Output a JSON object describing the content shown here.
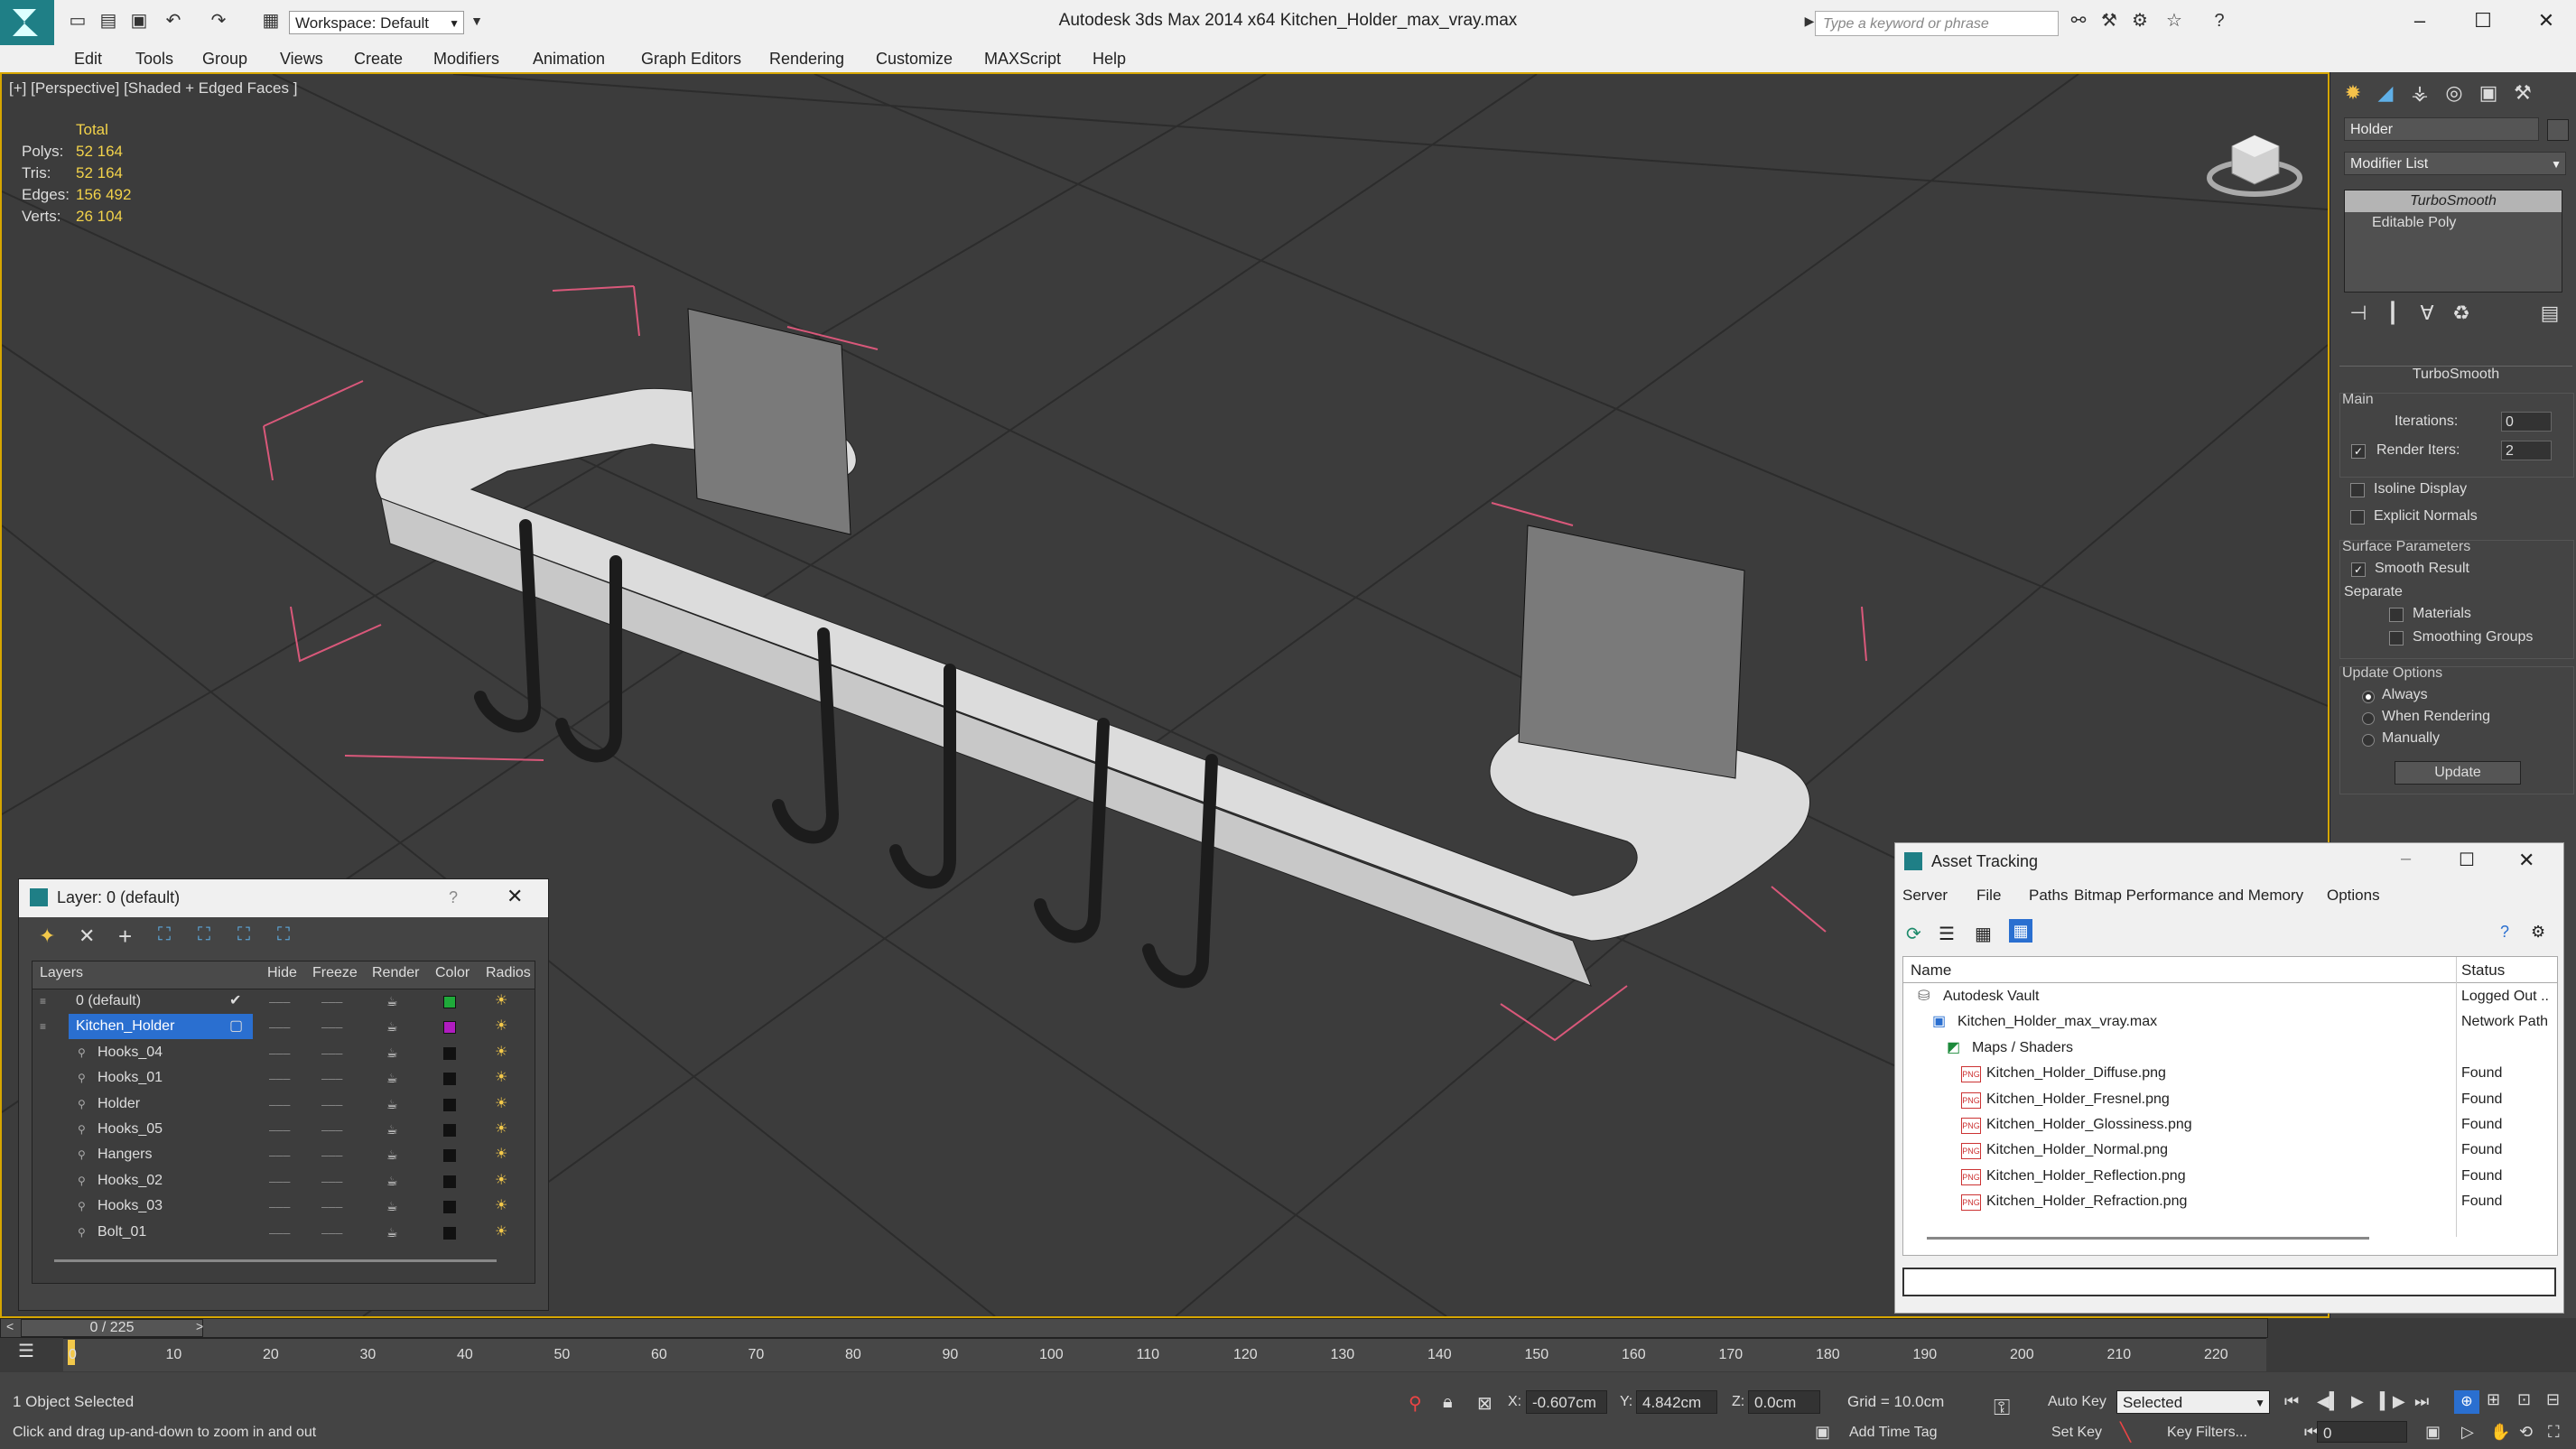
{
  "app": {
    "title": "Autodesk 3ds Max  2014 x64     Kitchen_Holder_max_vray.max",
    "workspace": "Workspace: Default",
    "search_placeholder": "Type a keyword or phrase"
  },
  "menu": [
    "Edit",
    "Tools",
    "Group",
    "Views",
    "Create",
    "Modifiers",
    "Animation",
    "Graph Editors",
    "Rendering",
    "Customize",
    "MAXScript",
    "Help"
  ],
  "viewport": {
    "label": "[+] [Perspective] [Shaded + Edged Faces ]",
    "stats": {
      "total_label": "Total",
      "rows": [
        {
          "key": "Polys:",
          "value": "52 164"
        },
        {
          "key": "Tris:",
          "value": "52 164"
        },
        {
          "key": "Edges:",
          "value": "156 492"
        },
        {
          "key": "Verts:",
          "value": "26 104"
        }
      ]
    }
  },
  "command_panel": {
    "object_name": "Holder",
    "modifier_list": "Modifier List",
    "stack": [
      "TurboSmooth",
      "Editable Poly"
    ],
    "rollout_title": "TurboSmooth",
    "main_label": "Main",
    "iterations_label": "Iterations:",
    "iterations_value": "0",
    "render_iters_label": "Render Iters:",
    "render_iters_value": "2",
    "isoline_label": "Isoline Display",
    "explicit_normals_label": "Explicit Normals",
    "surface_params_label": "Surface Parameters",
    "smooth_result_label": "Smooth Result",
    "separate_label": "Separate",
    "materials_label": "Materials",
    "smoothing_groups_label": "Smoothing Groups",
    "update_options_label": "Update Options",
    "always_label": "Always",
    "when_rendering_label": "When Rendering",
    "manually_label": "Manually",
    "update_button": "Update"
  },
  "layer_dialog": {
    "title": "Layer: 0 (default)",
    "help": "?",
    "columns": [
      "Layers",
      "Hide",
      "Freeze",
      "Render",
      "Color",
      "Radios"
    ],
    "rows": [
      {
        "name": "0 (default)",
        "color": "#1faa3a",
        "indent": 0
      },
      {
        "name": "Kitchen_Holder",
        "color": "#b01cc0",
        "indent": 0
      },
      {
        "name": "Hooks_04",
        "color": "#111111",
        "indent": 1
      },
      {
        "name": "Hooks_01",
        "color": "#111111",
        "indent": 1
      },
      {
        "name": "Holder",
        "color": "#111111",
        "indent": 1
      },
      {
        "name": "Hooks_05",
        "color": "#111111",
        "indent": 1
      },
      {
        "name": "Hangers",
        "color": "#111111",
        "indent": 1
      },
      {
        "name": "Hooks_02",
        "color": "#111111",
        "indent": 1
      },
      {
        "name": "Hooks_03",
        "color": "#111111",
        "indent": 1
      },
      {
        "name": "Bolt_01",
        "color": "#111111",
        "indent": 1
      }
    ]
  },
  "asset_tracking": {
    "title": "Asset Tracking",
    "menu": [
      "Server",
      "File",
      "Paths",
      "Bitmap Performance and Memory",
      "Options"
    ],
    "columns": [
      "Name",
      "Status"
    ],
    "rows": [
      {
        "name": "Autodesk Vault",
        "status": "Logged Out ..",
        "indent": 1
      },
      {
        "name": "Kitchen_Holder_max_vray.max",
        "status": "Network Path",
        "indent": 2
      },
      {
        "name": "Maps / Shaders",
        "status": "",
        "indent": 3
      },
      {
        "name": "Kitchen_Holder_Diffuse.png",
        "status": "Found",
        "indent": 4
      },
      {
        "name": "Kitchen_Holder_Fresnel.png",
        "status": "Found",
        "indent": 4
      },
      {
        "name": "Kitchen_Holder_Glossiness.png",
        "status": "Found",
        "indent": 4
      },
      {
        "name": "Kitchen_Holder_Normal.png",
        "status": "Found",
        "indent": 4
      },
      {
        "name": "Kitchen_Holder_Reflection.png",
        "status": "Found",
        "indent": 4
      },
      {
        "name": "Kitchen_Holder_Refraction.png",
        "status": "Found",
        "indent": 4
      }
    ]
  },
  "timeline": {
    "frame": "0 / 225",
    "ticks": [
      "0",
      "10",
      "20",
      "30",
      "40",
      "50",
      "60",
      "70",
      "80",
      "90",
      "100",
      "110",
      "120",
      "130",
      "140",
      "150",
      "160",
      "170",
      "180",
      "190",
      "200",
      "210",
      "220"
    ]
  },
  "status": {
    "selected": "1 Object Selected",
    "hint": "Click and drag up-and-down to zoom in and out",
    "x_label": "X:",
    "x_value": "-0.607cm",
    "y_label": "Y:",
    "y_value": "4.842cm",
    "z_label": "Z:",
    "z_value": "0.0cm",
    "grid": "Grid = 10.0cm",
    "add_time_tag": "Add Time Tag",
    "auto_key": "Auto Key",
    "set_key": "Set Key",
    "selected_mode": "Selected",
    "key_filters": "Key Filters...",
    "frame_field": "0"
  }
}
